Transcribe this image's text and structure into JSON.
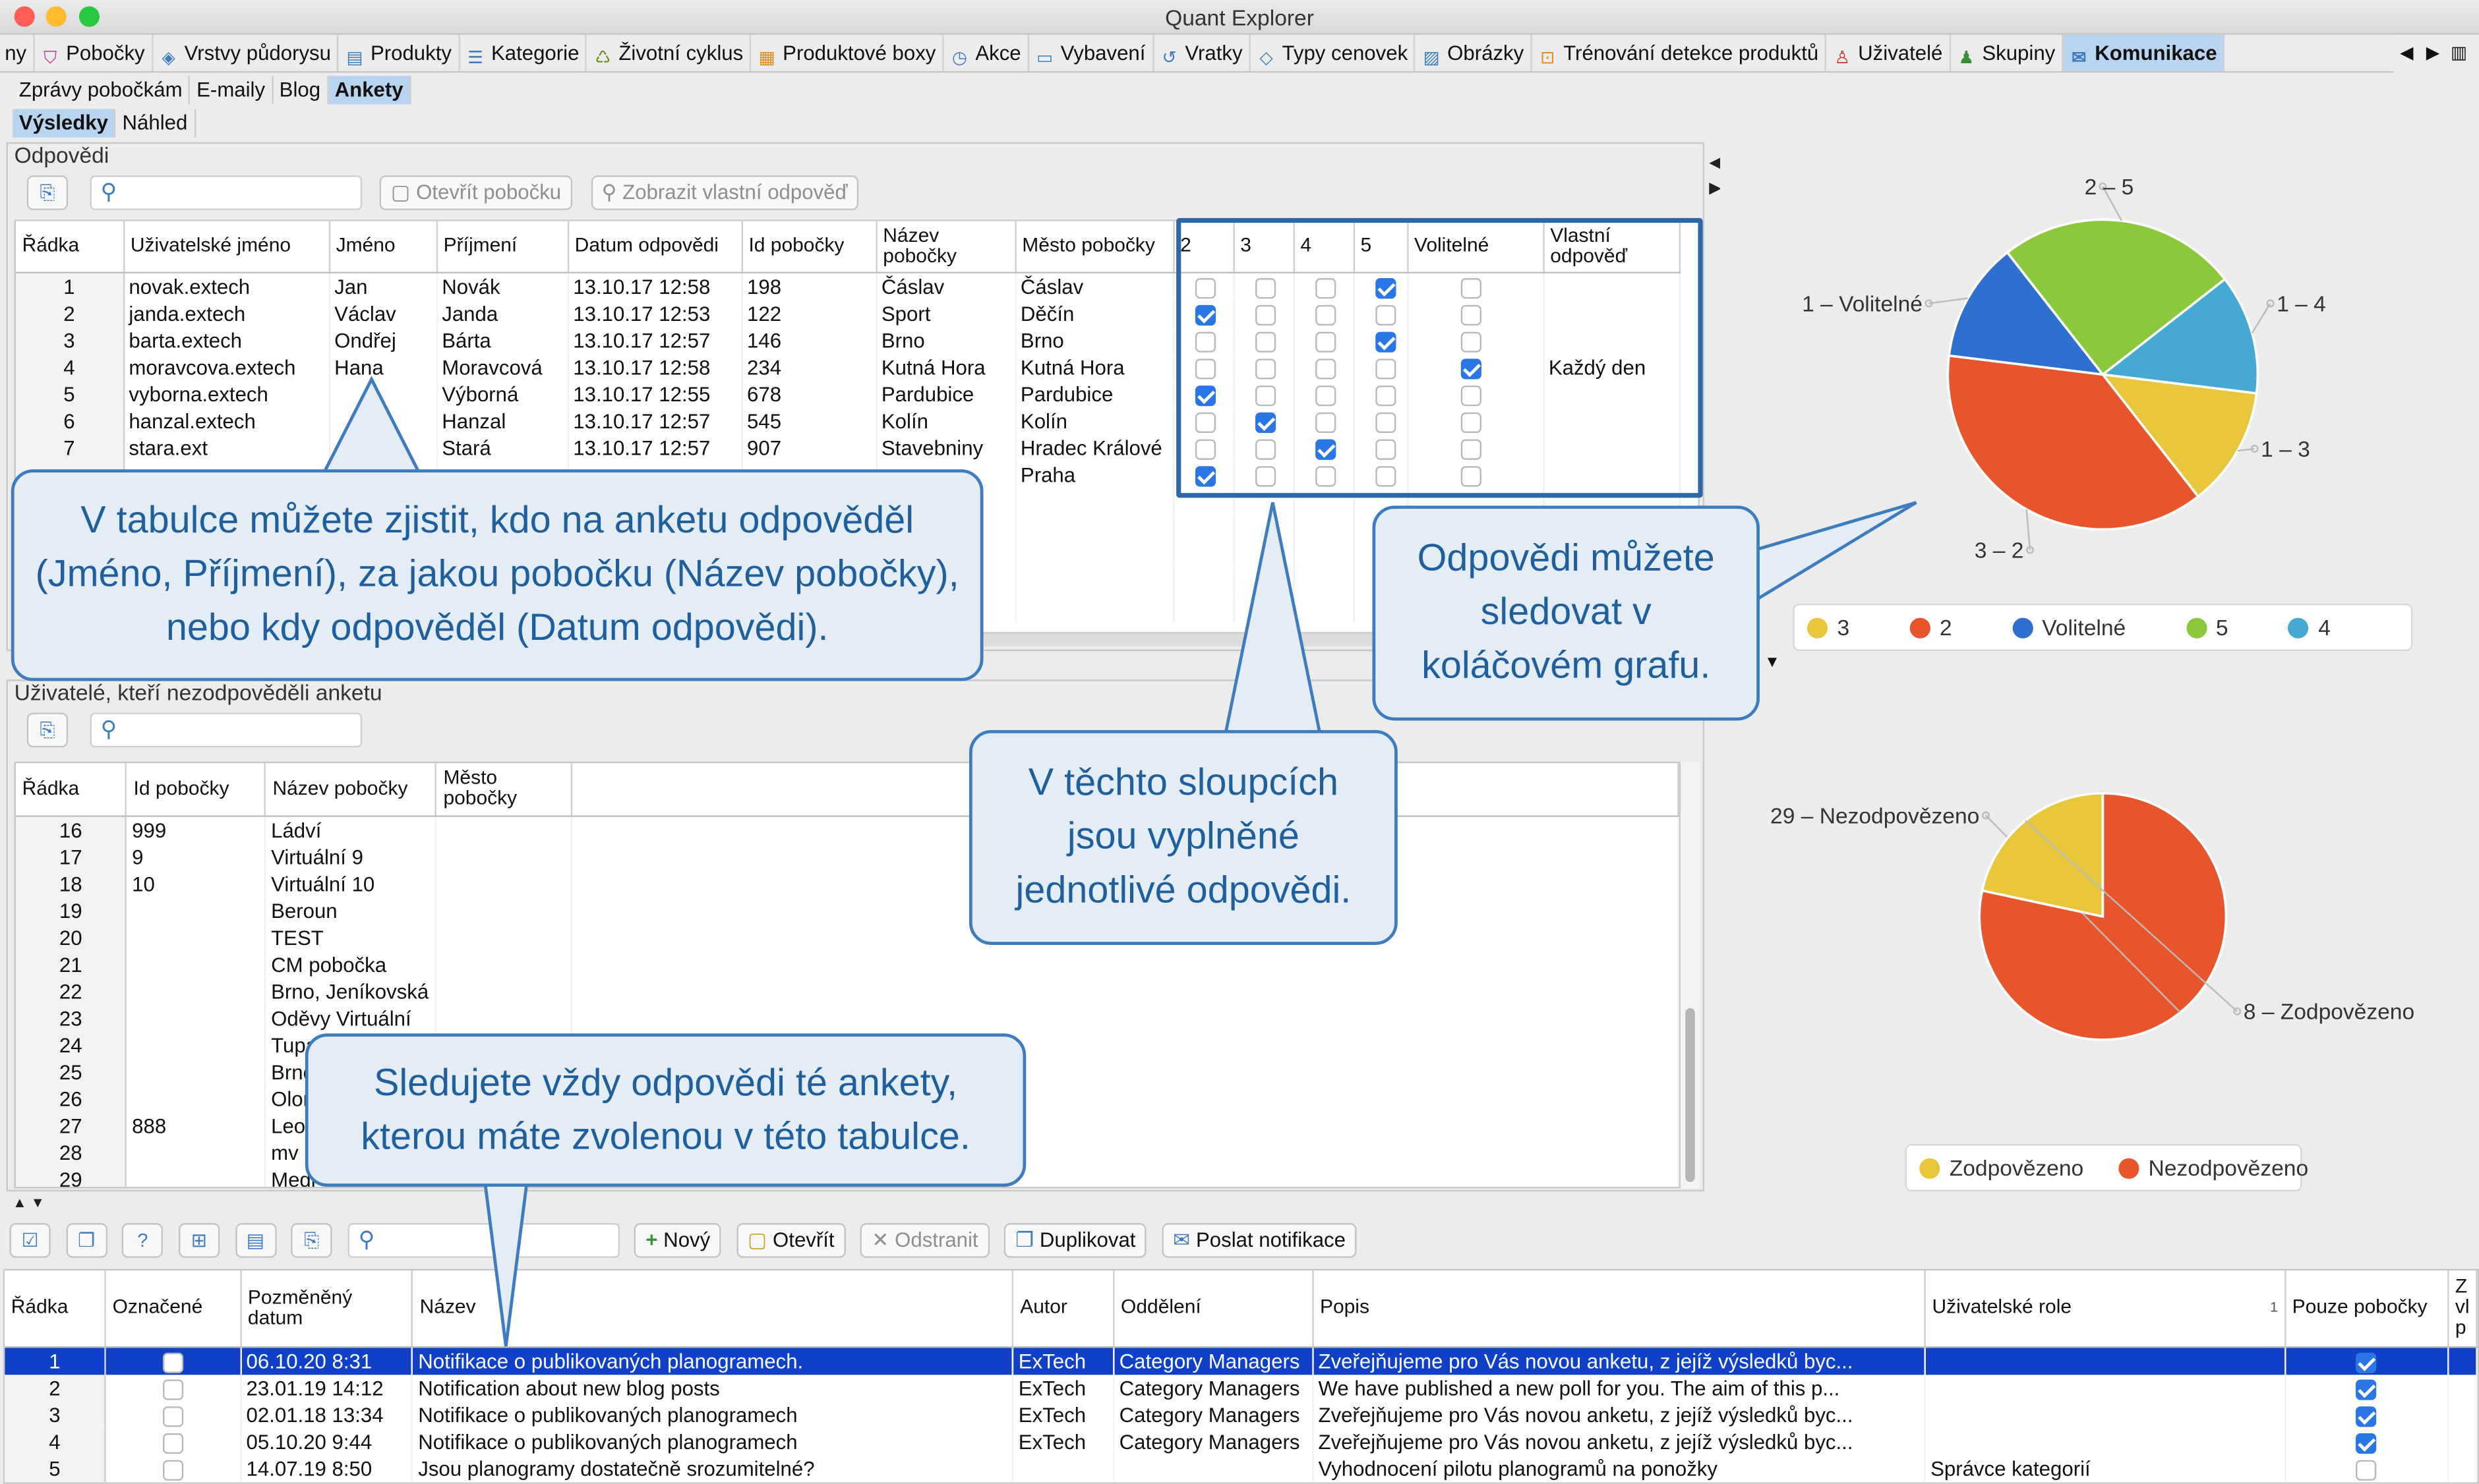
{
  "window": {
    "title": "Quant Explorer"
  },
  "toolbar": {
    "items": [
      {
        "label": "ny",
        "icon": "cut-off"
      },
      {
        "label": "Pobočky",
        "icon": "store-icon"
      },
      {
        "label": "Vrstvy půdorysu",
        "icon": "layers-icon"
      },
      {
        "label": "Produkty",
        "icon": "product-icon"
      },
      {
        "label": "Kategorie",
        "icon": "list-icon"
      },
      {
        "label": "Životní cyklus",
        "icon": "lifecycle-icon"
      },
      {
        "label": "Produktové boxy",
        "icon": "boxes-icon"
      },
      {
        "label": "Akce",
        "icon": "clock-icon"
      },
      {
        "label": "Vybavení",
        "icon": "equipment-icon"
      },
      {
        "label": "Vratky",
        "icon": "return-icon"
      },
      {
        "label": "Typy cenovek",
        "icon": "tag-icon"
      },
      {
        "label": "Obrázky",
        "icon": "image-icon"
      },
      {
        "label": "Trénování detekce produktů",
        "icon": "training-icon"
      },
      {
        "label": "Uživatelé",
        "icon": "user-icon"
      },
      {
        "label": "Skupiny",
        "icon": "group-icon"
      },
      {
        "label": "Komunikace",
        "icon": "envelope-icon"
      }
    ]
  },
  "subnav": {
    "tabs": [
      "Zprávy pobočkám",
      "E-maily",
      "Blog",
      "Ankety"
    ]
  },
  "subnav2": {
    "tabs": [
      "Výsledky",
      "Náhled"
    ]
  },
  "answers": {
    "section_title": "Odpovědi",
    "open_branch": "Otevřít pobočku",
    "show_own": "Zobrazit vlastní odpověď",
    "columns": [
      "Řádka",
      "Uživatelské jméno",
      "Jméno",
      "Příjmení",
      "Datum odpovědi",
      "Id pobočky",
      "Název pobočky",
      "Město pobočky",
      "2",
      "3",
      "4",
      "5",
      "Volitelné",
      "Vlastní odpověď"
    ],
    "rows": [
      {
        "n": "1",
        "user": "novak.extech",
        "first": "Jan",
        "last": "Novák",
        "date": "13.10.17 12:58",
        "id": "198",
        "branch": "Čáslav",
        "city": "Čáslav",
        "c2": false,
        "c3": false,
        "c4": false,
        "c5": true,
        "opt": false,
        "own": ""
      },
      {
        "n": "2",
        "user": "janda.extech",
        "first": "Václav",
        "last": "Janda",
        "date": "13.10.17 12:53",
        "id": "122",
        "branch": "Sport",
        "city": "Děčín",
        "c2": true,
        "c3": false,
        "c4": false,
        "c5": false,
        "opt": false,
        "own": ""
      },
      {
        "n": "3",
        "user": "barta.extech",
        "first": "Ondřej",
        "last": "Bárta",
        "date": "13.10.17 12:57",
        "id": "146",
        "branch": "Brno",
        "city": "Brno",
        "c2": false,
        "c3": false,
        "c4": false,
        "c5": true,
        "opt": false,
        "own": ""
      },
      {
        "n": "4",
        "user": "moravcova.extech",
        "first": "Hana",
        "last": "Moravcová",
        "date": "13.10.17 12:58",
        "id": "234",
        "branch": "Kutná Hora",
        "city": "Kutná Hora",
        "c2": false,
        "c3": false,
        "c4": false,
        "c5": false,
        "opt": true,
        "own": "Každý den"
      },
      {
        "n": "5",
        "user": "vyborna.extech",
        "first": "",
        "last": "Výborná",
        "date": "13.10.17 12:55",
        "id": "678",
        "branch": "Pardubice",
        "city": "Pardubice",
        "c2": true,
        "c3": false,
        "c4": false,
        "c5": false,
        "opt": false,
        "own": ""
      },
      {
        "n": "6",
        "user": "hanzal.extech",
        "first": "",
        "last": "Hanzal",
        "date": "13.10.17 12:57",
        "id": "545",
        "branch": "Kolín",
        "city": "Kolín",
        "c2": false,
        "c3": true,
        "c4": false,
        "c5": false,
        "opt": false,
        "own": ""
      },
      {
        "n": "7",
        "user": "stara.ext",
        "first": "",
        "last": "Stará",
        "date": "13.10.17 12:57",
        "id": "907",
        "branch": "Stavebniny",
        "city": "Hradec Králové",
        "c2": false,
        "c3": false,
        "c4": true,
        "c5": false,
        "opt": false,
        "own": ""
      },
      {
        "n": "",
        "user": "",
        "first": "",
        "last": "",
        "date": "",
        "id": "",
        "branch": "",
        "city": "Praha",
        "c2": true,
        "c3": false,
        "c4": false,
        "c5": false,
        "opt": false,
        "own": ""
      }
    ]
  },
  "unanswered": {
    "section_title": "Uživatelé, kteří nezodpověděli anketu",
    "columns": [
      "Řádka",
      "Id pobočky",
      "Název pobočky",
      "Město pobočky"
    ],
    "rows": [
      {
        "n": "16",
        "id": "999",
        "name": "Ládví"
      },
      {
        "n": "17",
        "id": "9",
        "name": "Virtuální 9"
      },
      {
        "n": "18",
        "id": "10",
        "name": "Virtuální 10"
      },
      {
        "n": "19",
        "id": "",
        "name": "Beroun"
      },
      {
        "n": "20",
        "id": "",
        "name": "TEST"
      },
      {
        "n": "21",
        "id": "",
        "name": "CM pobočka"
      },
      {
        "n": "22",
        "id": "",
        "name": "Brno, Jeníkovská"
      },
      {
        "n": "23",
        "id": "",
        "name": "Oděvy Virtuální"
      },
      {
        "n": "24",
        "id": "",
        "name": "Tupadl..."
      },
      {
        "n": "25",
        "id": "",
        "name": "Brno"
      },
      {
        "n": "26",
        "id": "",
        "name": "Olom"
      },
      {
        "n": "27",
        "id": "888",
        "name": "Leop"
      },
      {
        "n": "28",
        "id": "",
        "name": "mv"
      },
      {
        "n": "29",
        "id": "",
        "name": "Medl"
      }
    ]
  },
  "callouts": {
    "table": "V tabulce můžete zjistit, kdo na anketu odpověděl (Jméno, Příjmení), za jakou pobočku (Název pobočky), nebo kdy odpověděl (Datum odpovědi).",
    "columns": "V těchto sloupcích jsou vyplněné jednotlivé odpovědi.",
    "pie": "Odpovědi můžete sledovat v koláčovém grafu.",
    "poll": "Sledujete vždy odpovědi té ankety, kterou máte zvolenou v této tabulce."
  },
  "bottom": {
    "buttons": {
      "new": "Nový",
      "open": "Otevřít",
      "delete": "Odstranit",
      "duplicate": "Duplikovat",
      "notify": "Poslat notifikace"
    },
    "columns": [
      "Řádka",
      "Označené",
      "Pozměněný datum",
      "Název",
      "Autor",
      "Oddělení",
      "Popis",
      "Uživatelské role",
      "Pouze pobočky",
      "Z vl p"
    ],
    "sort_index": "1",
    "rows": [
      {
        "n": "1",
        "date": "06.10.20 8:31",
        "name": "Notifikace o publikovaných planogramech.",
        "author": "ExTech",
        "dept": "Category Managers",
        "desc": "Zveřejňujeme pro Vás novou anketu, z jejíž výsledků byc...",
        "roles": "",
        "only": true,
        "sel": true
      },
      {
        "n": "2",
        "date": "23.01.19 14:12",
        "name": "Notification about new blog posts",
        "author": "ExTech",
        "dept": "Category Managers",
        "desc": "We have published a new poll for you. The aim of this p...",
        "roles": "",
        "only": true,
        "sel": false
      },
      {
        "n": "3",
        "date": "02.01.18 13:34",
        "name": "Notifikace o publikovaných planogramech",
        "author": "ExTech",
        "dept": "Category Managers",
        "desc": "Zveřejňujeme pro Vás novou anketu, z jejíž výsledků byc...",
        "roles": "",
        "only": true,
        "sel": false
      },
      {
        "n": "4",
        "date": "05.10.20 9:44",
        "name": "Notifikace o publikovaných planogramech",
        "author": "ExTech",
        "dept": "Category Managers",
        "desc": "Zveřejňujeme pro Vás novou anketu, z jejíž výsledků byc...",
        "roles": "",
        "only": true,
        "sel": false
      },
      {
        "n": "5",
        "date": "14.07.19 8:50",
        "name": "Jsou planogramy dostatečně srozumitelné?",
        "author": "",
        "dept": "",
        "desc": "Vyhodnocení pilotu planogramů na ponožky",
        "roles": "Správce kategorií",
        "only": false,
        "sel": false
      }
    ]
  },
  "chart_data": [
    {
      "type": "pie",
      "series": [
        {
          "name": "3",
          "label": "1 – 3",
          "value": 1,
          "color": "#e8c63c"
        },
        {
          "name": "2",
          "label": "3 – 2",
          "value": 3,
          "color": "#e8542b"
        },
        {
          "name": "Volitelné",
          "label": "1 – Volitelné",
          "value": 1,
          "color": "#2f6fd0"
        },
        {
          "name": "5",
          "label": "2 – 5",
          "value": 2,
          "color": "#8cc83c"
        },
        {
          "name": "4",
          "label": "1 – 4",
          "value": 1,
          "color": "#45a9d4"
        }
      ],
      "legend": "bottom"
    },
    {
      "type": "pie",
      "series": [
        {
          "name": "Zodpovězeno",
          "label": "8 – Zodpovězeno",
          "value": 8,
          "color": "#e8c63c"
        },
        {
          "name": "Nezodpovězeno",
          "label": "29 – Nezodpovězeno",
          "value": 29,
          "color": "#e8542b"
        }
      ],
      "legend": "bottom"
    }
  ]
}
